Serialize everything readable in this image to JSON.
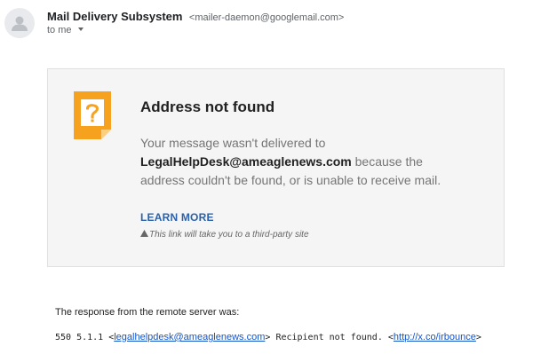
{
  "sender": {
    "name": "Mail Delivery Subsystem",
    "email": "<mailer-daemon@googlemail.com>",
    "icon": "default-avatar-icon"
  },
  "recipient": {
    "label": "to me"
  },
  "alert": {
    "icon": "question-note-icon",
    "title": "Address not found",
    "message_prefix": "Your message wasn't delivered to",
    "address": "LegalHelpDesk@ameaglenews.com",
    "message_suffix": "because the address couldn't be found, or is unable to receive mail.",
    "learn_more": "LEARN MORE",
    "third_party_note": "This link will take you to a third-party site",
    "colors": {
      "card_background": "#f5f5f5",
      "icon_orange": "#f6a21e",
      "link_blue": "#2962ab"
    }
  },
  "response": {
    "intro": "The response from the remote server was:",
    "code": "550 5.1.1",
    "recipient_link": "legalhelpdesk@ameaglenews.com",
    "status": "Recipient not found.",
    "bounce_link": "http://x.co/irbounce"
  }
}
